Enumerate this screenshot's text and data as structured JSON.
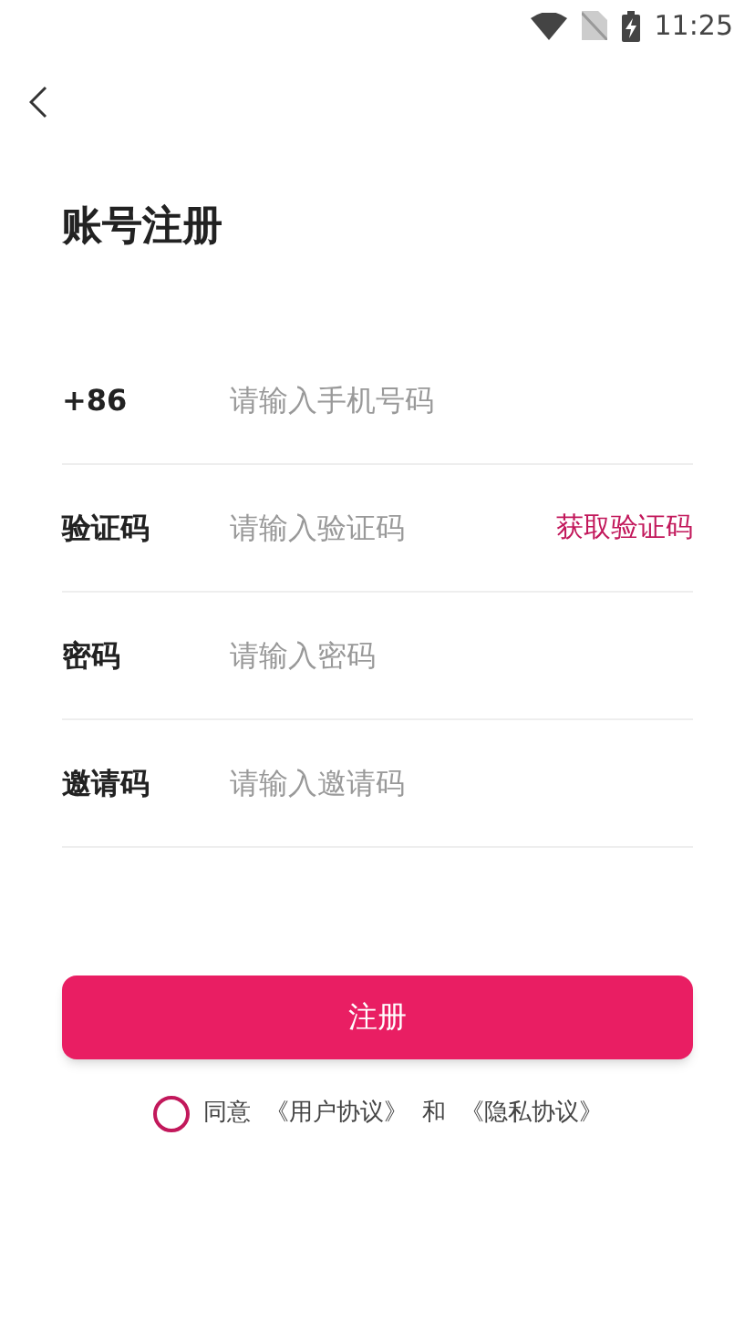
{
  "status_bar": {
    "time": "11:25"
  },
  "title": "账号注册",
  "fields": [
    {
      "kind": "text",
      "label": "+86",
      "placeholder": "请输入手机号码"
    },
    {
      "kind": "code",
      "label": "验证码",
      "placeholder": "请输入验证码",
      "action": "获取验证码"
    },
    {
      "kind": "text",
      "label": "密码",
      "placeholder": "请输入密码"
    },
    {
      "kind": "text",
      "label": "邀请码",
      "placeholder": "请输入邀请码"
    }
  ],
  "submit": "注册",
  "agreement": {
    "checked": false,
    "parts": [
      "同意",
      "《用户协议》",
      "和",
      "《隐私协议》"
    ]
  }
}
